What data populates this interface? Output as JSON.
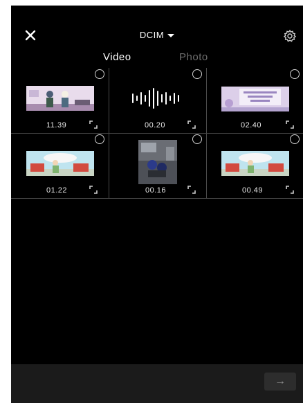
{
  "header": {
    "album": "DCIM"
  },
  "tabs": [
    {
      "label": "Video",
      "active": true
    },
    {
      "label": "Photo",
      "active": false
    }
  ],
  "media": [
    {
      "duration": "11.39",
      "kind": "classroom-animation"
    },
    {
      "duration": "00.20",
      "kind": "audio-waveform"
    },
    {
      "duration": "02.40",
      "kind": "title-slide"
    },
    {
      "duration": "01.22",
      "kind": "classroom-animation"
    },
    {
      "duration": "00.16",
      "kind": "street-photo"
    },
    {
      "duration": "00.49",
      "kind": "classroom-animation"
    }
  ],
  "footer": {
    "next_glyph": "→"
  },
  "colors": {
    "background": "#000000",
    "divider": "#4a4a4a",
    "active_tab": "#ffffff",
    "inactive_tab": "#6e6e6e",
    "bottom_bar": "#1b1b1b"
  }
}
